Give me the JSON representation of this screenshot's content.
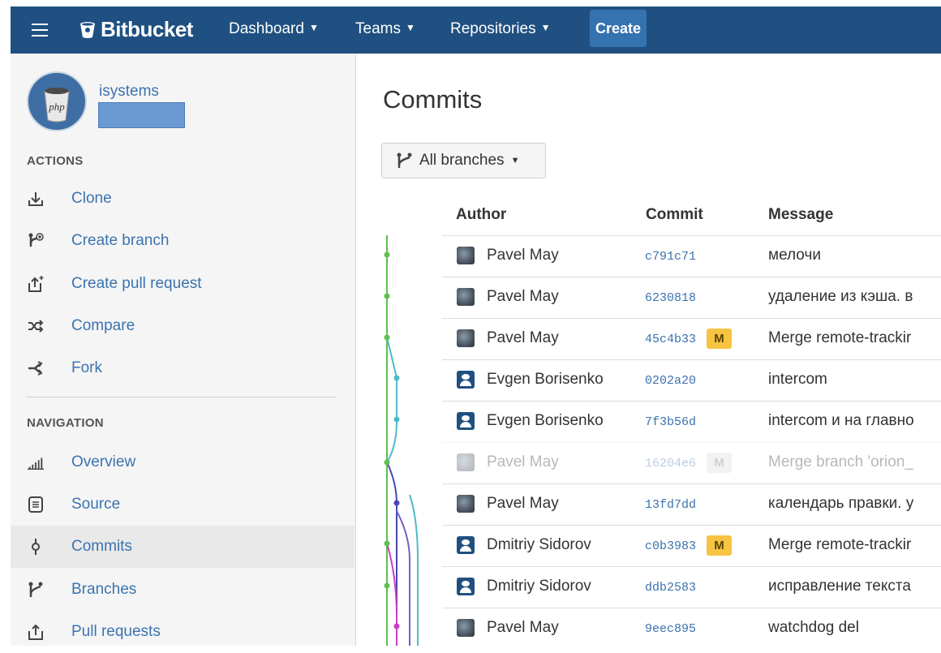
{
  "topnav": {
    "brand": "Bitbucket",
    "items": [
      {
        "label": "Dashboard"
      },
      {
        "label": "Teams"
      },
      {
        "label": "Repositories"
      }
    ],
    "create_label": "Create"
  },
  "sidebar": {
    "owner": "isystems",
    "actions_heading": "ACTIONS",
    "actions": [
      {
        "label": "Clone",
        "icon": "clone-icon"
      },
      {
        "label": "Create branch",
        "icon": "create-branch-icon"
      },
      {
        "label": "Create pull request",
        "icon": "create-pull-request-icon"
      },
      {
        "label": "Compare",
        "icon": "compare-icon"
      },
      {
        "label": "Fork",
        "icon": "fork-icon"
      }
    ],
    "navigation_heading": "NAVIGATION",
    "navigation": [
      {
        "label": "Overview",
        "icon": "overview-icon"
      },
      {
        "label": "Source",
        "icon": "source-icon"
      },
      {
        "label": "Commits",
        "icon": "commits-icon",
        "active": true
      },
      {
        "label": "Branches",
        "icon": "branches-icon"
      },
      {
        "label": "Pull requests",
        "icon": "pull-requests-icon"
      }
    ]
  },
  "main": {
    "title": "Commits",
    "branch_filter": "All branches",
    "columns": {
      "author": "Author",
      "commit": "Commit",
      "message": "Message"
    },
    "commits": [
      {
        "author": "Pavel May",
        "avatar": "photo",
        "hash": "c791c71",
        "merge": "",
        "message": "мелочи"
      },
      {
        "author": "Pavel May",
        "avatar": "photo",
        "hash": "6230818",
        "merge": "",
        "message": "удаление из кэша. в"
      },
      {
        "author": "Pavel May",
        "avatar": "photo",
        "hash": "45c4b33",
        "merge": "M",
        "message": "Merge remote-trackir"
      },
      {
        "author": "Evgen Borisenko",
        "avatar": "default",
        "hash": "0202a20",
        "merge": "",
        "message": "intercom"
      },
      {
        "author": "Evgen Borisenko",
        "avatar": "default",
        "hash": "7f3b56d",
        "merge": "",
        "message": "intercom и на главно"
      },
      {
        "author": "Pavel May",
        "avatar": "photo",
        "hash": "16204e6",
        "merge": "M",
        "message": "Merge branch 'orion_",
        "faded": true
      },
      {
        "author": "Pavel May",
        "avatar": "photo",
        "hash": "13fd7dd",
        "merge": "",
        "message": "календарь правки. у"
      },
      {
        "author": "Dmitriy Sidorov",
        "avatar": "default",
        "hash": "c0b3983",
        "merge": "M",
        "message": "Merge remote-trackir"
      },
      {
        "author": "Dmitriy Sidorov",
        "avatar": "default",
        "hash": "ddb2583",
        "merge": "",
        "message": "исправление текста"
      },
      {
        "author": "Pavel May",
        "avatar": "photo",
        "hash": "9eec895",
        "merge": "",
        "message": "watchdog del"
      }
    ]
  }
}
